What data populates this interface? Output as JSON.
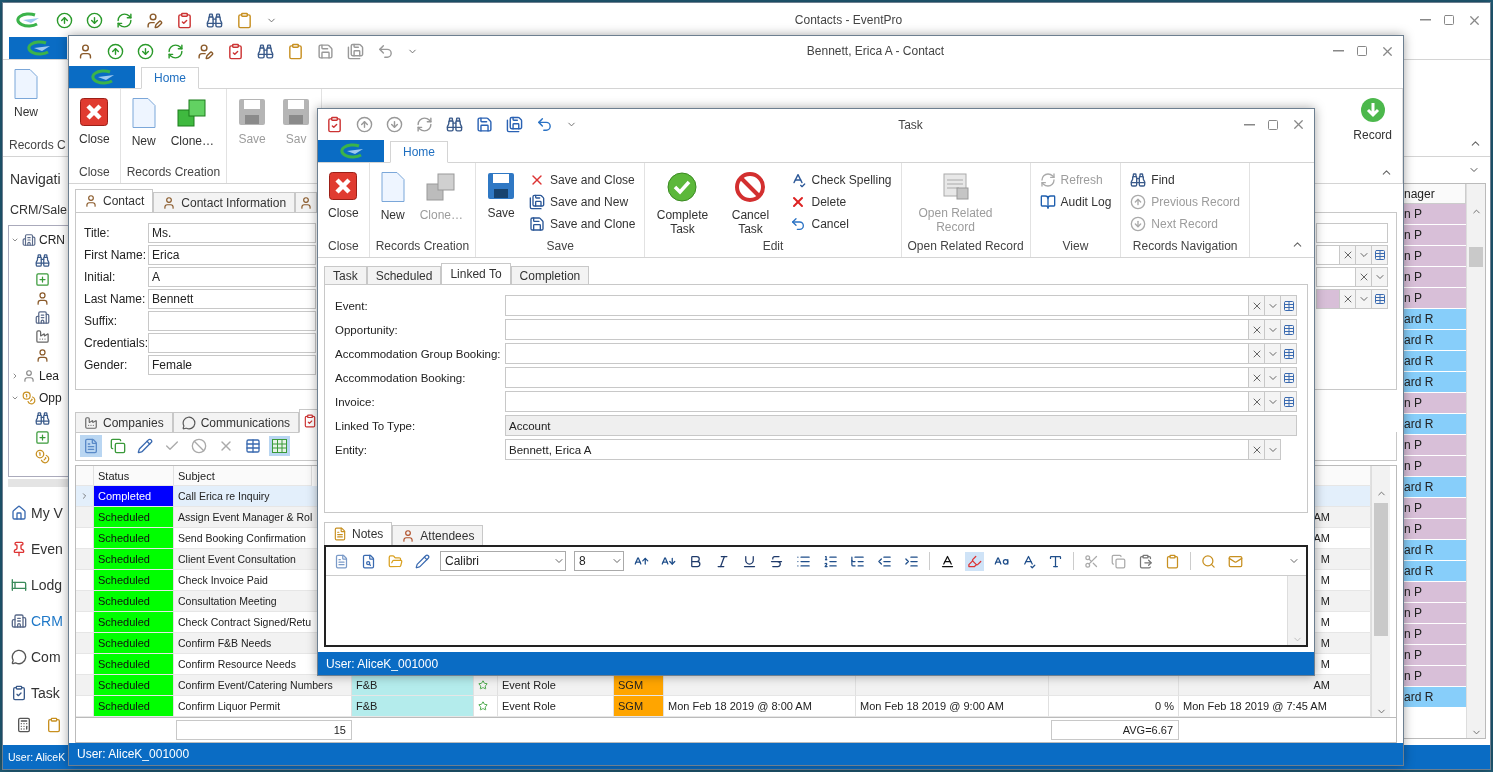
{
  "main_window": {
    "title": "Contacts - EventPro",
    "ribbon": {
      "button": "New",
      "group": "Records C"
    },
    "navigation": {
      "header": "Navigati",
      "section": "CRM/Sale",
      "tree": [
        {
          "label": "CRN",
          "expanded": true,
          "children": [
            {
              "kind": "search"
            },
            {
              "kind": "add"
            },
            {
              "kind": "person"
            },
            {
              "kind": "building"
            },
            {
              "kind": "factory"
            },
            {
              "kind": "person"
            }
          ]
        },
        {
          "label": "Lea",
          "expanded": false
        },
        {
          "label": "Opp",
          "expanded": true,
          "children": [
            {
              "kind": "search"
            },
            {
              "kind": "add"
            },
            {
              "kind": "coins"
            }
          ]
        }
      ],
      "items": [
        {
          "label": "My V",
          "selected": false
        },
        {
          "label": "Even",
          "selected": false
        },
        {
          "label": "Lodg",
          "selected": false
        },
        {
          "label": "CRM",
          "selected": true
        },
        {
          "label": "Com",
          "selected": false
        },
        {
          "label": "Task",
          "selected": false
        }
      ]
    },
    "grid": {
      "column": "nager",
      "rows": [
        {
          "text": "n P",
          "color": "#d8bfd8"
        },
        {
          "text": "n P",
          "color": "#d8bfd8"
        },
        {
          "text": "n P",
          "color": "#d8bfd8"
        },
        {
          "text": "n P",
          "color": "#d8bfd8"
        },
        {
          "text": "n P",
          "color": "#d8bfd8"
        },
        {
          "text": "ard R",
          "color": "#87cefa"
        },
        {
          "text": "ard R",
          "color": "#87cefa"
        },
        {
          "text": "ard R",
          "color": "#87cefa"
        },
        {
          "text": "ard R",
          "color": "#87cefa"
        },
        {
          "text": "n P",
          "color": "#d8bfd8"
        },
        {
          "text": "ard R",
          "color": "#87cefa"
        },
        {
          "text": "n P",
          "color": "#d8bfd8"
        },
        {
          "text": "n P",
          "color": "#d8bfd8"
        },
        {
          "text": "ard R",
          "color": "#87cefa"
        },
        {
          "text": "n P",
          "color": "#d8bfd8"
        },
        {
          "text": "n P",
          "color": "#d8bfd8"
        },
        {
          "text": "ard R",
          "color": "#87cefa"
        },
        {
          "text": "ard R",
          "color": "#87cefa"
        },
        {
          "text": "n P",
          "color": "#d8bfd8"
        },
        {
          "text": "n P",
          "color": "#d8bfd8"
        },
        {
          "text": "n P",
          "color": "#d8bfd8"
        },
        {
          "text": "n P",
          "color": "#d8bfd8"
        },
        {
          "text": "n P",
          "color": "#d8bfd8"
        },
        {
          "text": "ard R",
          "color": "#87cefa"
        }
      ]
    },
    "status": "User: AliceK"
  },
  "contact_window": {
    "title": "Bennett, Erica A - Contact",
    "ribbon_tab": "Home",
    "ribbon": {
      "groups": [
        {
          "label": "Close",
          "buttons": [
            {
              "label": "Close",
              "disabled": false
            }
          ]
        },
        {
          "label": "Records Creation",
          "buttons": [
            {
              "label": "New",
              "disabled": false
            },
            {
              "label": "Clone…",
              "disabled": false
            }
          ]
        },
        {
          "buttons": [
            {
              "label": "Save",
              "disabled": true
            },
            {
              "label": "Sav",
              "disabled": true
            }
          ]
        }
      ],
      "far_button": "Record"
    },
    "tabs": [
      {
        "label": "Contact",
        "selected": true
      },
      {
        "label": "Contact Information",
        "selected": false
      },
      {
        "selected": false
      }
    ],
    "fields": [
      {
        "label": "Title:",
        "value": "Ms."
      },
      {
        "label": "First Name:",
        "value": "Erica"
      },
      {
        "label": "Initial:",
        "value": "A"
      },
      {
        "label": "Last Name:",
        "value": "Bennett"
      },
      {
        "label": "Suffix:"
      },
      {
        "label": "Credentials:"
      },
      {
        "label": "Gender:",
        "value": "Female"
      }
    ],
    "side_fields": [
      {
        "kind": "text",
        "highlighted": false
      },
      {
        "kind": "lookup",
        "highlighted": false
      },
      {
        "kind": "combo",
        "highlighted": false
      },
      {
        "kind": "lookup",
        "highlighted": true
      }
    ],
    "subtabs": [
      {
        "label": "Companies",
        "selected": false
      },
      {
        "label": "Communications",
        "selected": false
      },
      {
        "selected": true
      }
    ],
    "tasks": {
      "columns": [
        "Status",
        "Subject"
      ],
      "rows": [
        {
          "status": "Completed",
          "color": "#0000ff",
          "subject": "Call Erica re Inquiry",
          "current": true
        },
        {
          "status": "Scheduled",
          "color": "#00ff00",
          "subject": "Assign Event Manager & Rol",
          "current": false,
          "tail": "AM"
        },
        {
          "status": "Scheduled",
          "color": "#00ff00",
          "subject": "Send Booking Confirmation",
          "current": false,
          "tail": "AM"
        },
        {
          "status": "Scheduled",
          "color": "#00ff00",
          "subject": "Client Event Consultation",
          "current": false,
          "tail": "M"
        },
        {
          "status": "Scheduled",
          "color": "#00ff00",
          "subject": "Check Invoice Paid",
          "current": false,
          "tail": "M"
        },
        {
          "status": "Scheduled",
          "color": "#00ff00",
          "subject": "Consultation Meeting",
          "current": false,
          "tail": "M"
        },
        {
          "status": "Scheduled",
          "color": "#00ff00",
          "subject": "Check Contract Signed/Retu",
          "current": false,
          "tail": "M"
        },
        {
          "status": "Scheduled",
          "color": "#00ff00",
          "subject": "Confirm F&B Needs",
          "current": false,
          "tail": "M"
        },
        {
          "status": "Scheduled",
          "color": "#00ff00",
          "subject": "Confirm Resource Needs",
          "current": false,
          "tail": "M"
        },
        {
          "status": "Scheduled",
          "color": "#00ff00",
          "subject": "Confirm Event/Catering Numbers",
          "current": false,
          "cells": [
            "F&B",
            "Event Role",
            "SGM"
          ],
          "tail": "AM"
        },
        {
          "status": "Scheduled",
          "color": "#00ff00",
          "subject": "Confirm Liquor Permit",
          "current": false,
          "cells": [
            "F&B",
            "Event Role",
            "SGM",
            "Mon Feb 18 2019 @ 8:00 AM",
            "Mon Feb 18 2019 @ 9:00 AM",
            "0 %",
            "Mon Feb 18 2019 @ 7:45 AM"
          ]
        }
      ],
      "count": "15",
      "average": "AVG=6.67"
    },
    "status": "User: AliceK_001000"
  },
  "task_window": {
    "title": "Task",
    "ribbon_tab": "Home",
    "ribbon": {
      "groups": [
        {
          "label": "Close",
          "items": [
            {
              "label": "Close",
              "kind": "large",
              "disabled": false
            }
          ]
        },
        {
          "label": "Records Creation",
          "items": [
            {
              "label": "New",
              "kind": "large",
              "disabled": false
            },
            {
              "label": "Clone…",
              "kind": "large",
              "disabled": true
            }
          ]
        },
        {
          "label": "Save",
          "items": [
            {
              "label": "Save",
              "kind": "large",
              "disabled": false
            },
            {
              "label": "Save and Close",
              "kind": "small",
              "disabled": false
            },
            {
              "label": "Save and New",
              "kind": "small",
              "disabled": false
            },
            {
              "label": "Save and Clone",
              "kind": "small",
              "disabled": false
            }
          ]
        },
        {
          "label": "Edit",
          "items": [
            {
              "label": "Complete Task",
              "kind": "large",
              "disabled": false
            },
            {
              "label": "Cancel Task",
              "kind": "large",
              "disabled": false
            },
            {
              "label": "Check Spelling",
              "kind": "small",
              "disabled": false
            },
            {
              "label": "Delete",
              "kind": "small",
              "disabled": false
            },
            {
              "label": "Cancel",
              "kind": "small",
              "disabled": false
            }
          ]
        },
        {
          "label": "Open Related Record",
          "items": [
            {
              "label": "Open Related Record",
              "kind": "large",
              "disabled": true
            }
          ]
        },
        {
          "label": "View",
          "items": [
            {
              "label": "Refresh",
              "kind": "small",
              "disabled": true
            },
            {
              "label": "Audit Log",
              "kind": "small",
              "disabled": false
            }
          ]
        },
        {
          "label": "Records Navigation",
          "items": [
            {
              "label": "Find",
              "kind": "small",
              "disabled": false
            },
            {
              "label": "Previous Record",
              "kind": "small",
              "disabled": true
            },
            {
              "label": "Next Record",
              "kind": "small",
              "disabled": true
            }
          ]
        }
      ]
    },
    "tabs": [
      {
        "label": "Task",
        "selected": false
      },
      {
        "label": "Scheduled",
        "selected": false
      },
      {
        "label": "Linked To",
        "selected": true
      },
      {
        "label": "Completion",
        "selected": false
      }
    ],
    "fields": [
      {
        "label": "Event:",
        "kind": "lookup"
      },
      {
        "label": "Opportunity:",
        "kind": "lookup"
      },
      {
        "label": "Accommodation Group Booking:",
        "kind": "lookup"
      },
      {
        "label": "Accommodation Booking:",
        "kind": "lookup"
      },
      {
        "label": "Invoice:",
        "kind": "lookup"
      },
      {
        "label": "Linked To Type:",
        "kind": "readonly",
        "value": "Account"
      },
      {
        "label": "Entity:",
        "kind": "combo",
        "value": "Bennett, Erica A"
      }
    ],
    "notes_tabs": [
      {
        "label": "Notes",
        "selected": true
      },
      {
        "label": "Attendees",
        "selected": false
      }
    ],
    "editor": {
      "font": "Calibri",
      "size": "8"
    },
    "status": "User: AliceK_001000"
  }
}
